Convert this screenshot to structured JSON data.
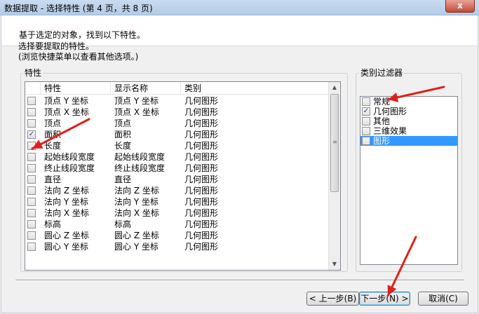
{
  "window": {
    "title": "数据提取 - 选择特性 (第 4 页，共 8 页)",
    "close_label": "x"
  },
  "header": {
    "text": "基于选定的对象，找到以下特性。"
  },
  "instructions": {
    "line1": "选择要提取的特性。",
    "line2": "(浏览快捷菜单以查看其他选项。)"
  },
  "properties": {
    "group_label": "特性",
    "columns": [
      "特性",
      "显示名称",
      "类别"
    ],
    "rows": [
      {
        "checked": false,
        "name": "顶点 Y 坐标",
        "display": "顶点 Y 坐标",
        "category": "几何图形"
      },
      {
        "checked": false,
        "name": "顶点 X 坐标",
        "display": "顶点 X 坐标",
        "category": "几何图形"
      },
      {
        "checked": false,
        "name": "顶点",
        "display": "顶点",
        "category": "几何图形"
      },
      {
        "checked": true,
        "name": "面积",
        "display": "面积",
        "category": "几何图形"
      },
      {
        "checked": false,
        "name": "长度",
        "display": "长度",
        "category": "几何图形"
      },
      {
        "checked": false,
        "name": "起始线段宽度",
        "display": "起始线段宽度",
        "category": "几何图形"
      },
      {
        "checked": false,
        "name": "终止线段宽度",
        "display": "终止线段宽度",
        "category": "几何图形"
      },
      {
        "checked": false,
        "name": "直径",
        "display": "直径",
        "category": "几何图形"
      },
      {
        "checked": false,
        "name": "法向 Z 坐标",
        "display": "法向 Z 坐标",
        "category": "几何图形"
      },
      {
        "checked": false,
        "name": "法向 Y 坐标",
        "display": "法向 Y 坐标",
        "category": "几何图形"
      },
      {
        "checked": false,
        "name": "法向 X 坐标",
        "display": "法向 X 坐标",
        "category": "几何图形"
      },
      {
        "checked": false,
        "name": "标高",
        "display": "标高",
        "category": "几何图形"
      },
      {
        "checked": false,
        "name": "圆心 Z 坐标",
        "display": "圆心 Z 坐标",
        "category": "几何图形"
      },
      {
        "checked": false,
        "name": "圆心 Y 坐标",
        "display": "圆心 Y 坐标",
        "category": "几何图形"
      }
    ]
  },
  "category_filter": {
    "group_label": "类别过滤器",
    "items": [
      {
        "checked": false,
        "label": "常规",
        "selected": false
      },
      {
        "checked": true,
        "label": "几何图形",
        "selected": false
      },
      {
        "checked": false,
        "label": "其他",
        "selected": false
      },
      {
        "checked": false,
        "label": "三维效果",
        "selected": false
      },
      {
        "checked": false,
        "label": "图形",
        "selected": true
      }
    ]
  },
  "buttons": {
    "prev": "< 上一步(B)",
    "next": "下一步(N) >",
    "cancel": "取消(C)"
  },
  "colors": {
    "annotation_arrow": "#e0201b",
    "selection": "#3399ff"
  }
}
